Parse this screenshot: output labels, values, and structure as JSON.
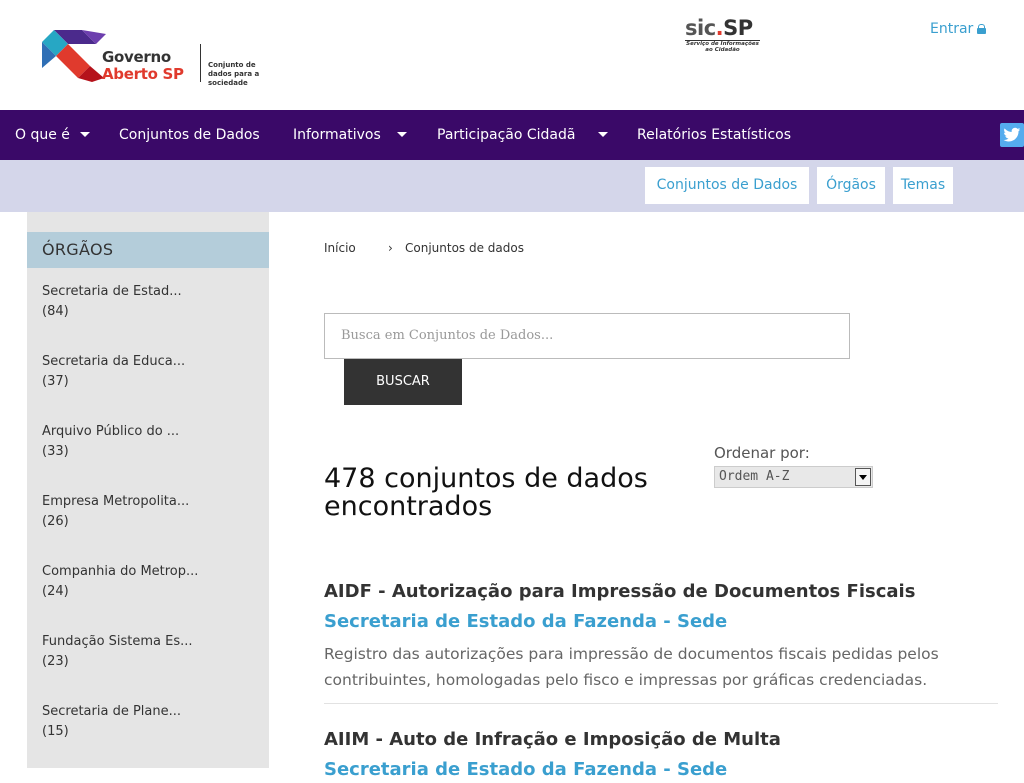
{
  "header": {
    "logo_line1": "Governo",
    "logo_line2": "Aberto SP",
    "logo_tagline": "Conjunto de dados para a sociedade",
    "sic_title": "sic.SP",
    "sic_subtitle": "Serviço de Informações ao Cidadão",
    "login_label": "Entrar"
  },
  "nav": {
    "items": [
      {
        "label": "O que é",
        "dropdown": true
      },
      {
        "label": "Conjuntos de Dados",
        "dropdown": false
      },
      {
        "label": "Informativos",
        "dropdown": true
      },
      {
        "label": "Participação Cidadã",
        "dropdown": true
      },
      {
        "label": "Relatórios Estatísticos",
        "dropdown": false
      }
    ],
    "social_icon": "twitter-icon"
  },
  "subbar": {
    "buttons": [
      "Conjuntos de Dados",
      "Órgãos",
      "Temas"
    ]
  },
  "sidebar": {
    "heading": "ÓRGÃOS",
    "items": [
      {
        "name": "Secretaria de Estad...",
        "count": "(84)"
      },
      {
        "name": "Secretaria da Educa...",
        "count": "(37)"
      },
      {
        "name": "Arquivo Público do ...",
        "count": "(33)"
      },
      {
        "name": "Empresa Metropolita...",
        "count": "(26)"
      },
      {
        "name": "Companhia do Metrop...",
        "count": "(24)"
      },
      {
        "name": "Fundação Sistema Es...",
        "count": "(23)"
      },
      {
        "name": "Secretaria de Plane...",
        "count": "(15)"
      }
    ]
  },
  "breadcrumb": {
    "home": "Início",
    "current": "Conjuntos de dados"
  },
  "search": {
    "placeholder": "Busca em Conjuntos de Dados...",
    "button_label": "BUSCAR"
  },
  "results": {
    "count_text": "478 conjuntos de dados encontrados",
    "sort_label": "Ordenar por:",
    "sort_value": "Ordem A-Z"
  },
  "datasets": [
    {
      "title": "AIDF - Autorização para Impressão de Documentos Fiscais",
      "org": "Secretaria de Estado da Fazenda - Sede",
      "description": "Registro das autorizações para impressão de documentos fiscais pedidas pelos contribuintes, homologadas pelo fisco e impressas por gráficas credenciadas."
    },
    {
      "title": "AIIM - Auto de Infração e Imposição de Multa",
      "org": "Secretaria de Estado da Fazenda - Sede",
      "description": ""
    }
  ],
  "colors": {
    "nav_bg": "#3a0968",
    "subbar_bg": "#d4d6ea",
    "sidebar_bg": "#e5e5e5",
    "sidebar_head_bg": "#b4cdda",
    "link": "#3a9fcf"
  }
}
